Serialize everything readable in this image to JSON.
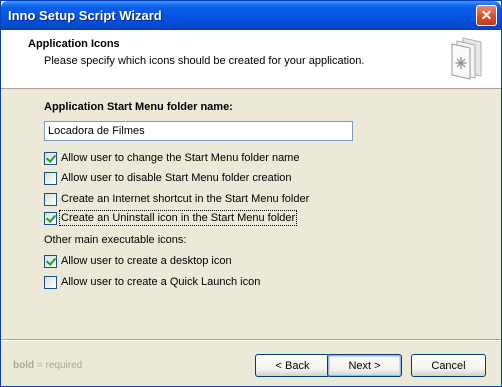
{
  "window": {
    "title": "Inno Setup Script Wizard",
    "close_symbol": "✕"
  },
  "header": {
    "title": "Application Icons",
    "subtitle": "Please specify which icons should be created for your application.",
    "icon": "wizard-page-icon"
  },
  "form": {
    "folder_label": "Application Start Menu folder name:",
    "folder_value": "Locadora de Filmes",
    "options": [
      {
        "label": "Allow user to change the Start Menu folder name",
        "checked": true
      },
      {
        "label": "Allow user to disable Start Menu folder creation",
        "checked": false
      },
      {
        "label": "Create an Internet shortcut in the Start Menu folder",
        "checked": false
      },
      {
        "label": "Create an Uninstall icon in the Start Menu folder",
        "checked": true
      }
    ],
    "other_label": "Other main executable icons:",
    "other_options": [
      {
        "label": "Allow user to create a desktop icon",
        "checked": true
      },
      {
        "label": "Allow user to create a Quick Launch icon",
        "checked": false
      }
    ]
  },
  "footer": {
    "legend_bold": "bold",
    "legend_rest": " = required",
    "back_label": "< Back",
    "next_label": "Next >",
    "cancel_label": "Cancel"
  },
  "colors": {
    "titlebar": "#0454e0",
    "face": "#ece9d8",
    "checkmark": "#21a121"
  }
}
